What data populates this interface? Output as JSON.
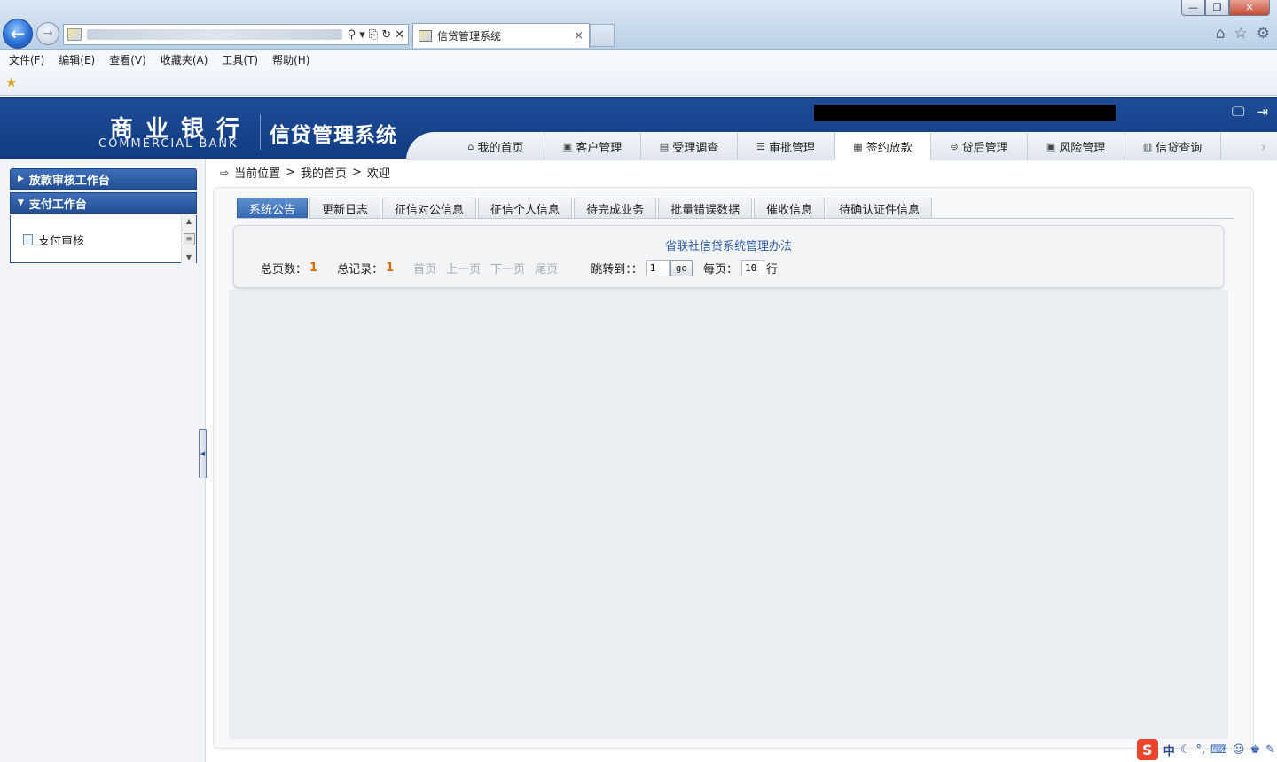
{
  "browser": {
    "tab_title": "信贷管理系统",
    "tab_close": "×",
    "window_min": "—",
    "window_max": "❐",
    "window_close": "✕",
    "back_glyph": "←",
    "fwd_glyph": "→",
    "addr_search": "⚲ ▾",
    "addr_compat": "⎘",
    "addr_refresh": "↻",
    "addr_stop": "✕",
    "home_glyph": "⌂",
    "fav_glyph": "☆",
    "tools_glyph": "⚙",
    "menu": [
      "文件(F)",
      "编辑(E)",
      "查看(V)",
      "收藏夹(A)",
      "工具(T)",
      "帮助(H)"
    ]
  },
  "header": {
    "logo_cn": "商业银行",
    "logo_en": "COMMERCIAL BANK",
    "system_title": "信贷管理系统",
    "nav_tabs": [
      {
        "label": "我的首页",
        "icon": "home-icon"
      },
      {
        "label": "客户管理",
        "icon": "customer-icon"
      },
      {
        "label": "受理调查",
        "icon": "survey-icon"
      },
      {
        "label": "审批管理",
        "icon": "approval-icon"
      },
      {
        "label": "签约放款",
        "icon": "contract-icon",
        "active": true
      },
      {
        "label": "贷后管理",
        "icon": "postloan-icon"
      },
      {
        "label": "风险管理",
        "icon": "risk-icon"
      },
      {
        "label": "信贷查询",
        "icon": "query-icon"
      }
    ]
  },
  "sidebar": {
    "groups": [
      {
        "label": "放款审核工作台",
        "expanded": false
      },
      {
        "label": "支付工作台",
        "expanded": true
      }
    ],
    "items": [
      {
        "label": "支付审核"
      }
    ]
  },
  "breadcrumb": {
    "label": "当前位置",
    "items": [
      "我的首页",
      "欢迎"
    ],
    "separator": ">"
  },
  "sub_tabs": [
    {
      "label": "系统公告",
      "active": true
    },
    {
      "label": "更新日志"
    },
    {
      "label": "征信对公信息"
    },
    {
      "label": "征信个人信息"
    },
    {
      "label": "待完成业务"
    },
    {
      "label": "批量错误数据"
    },
    {
      "label": "催收信息"
    },
    {
      "label": "待确认证件信息"
    }
  ],
  "notice": {
    "link_text": "省联社信贷系统管理办法"
  },
  "pager": {
    "total_pages_label": "总页数：",
    "total_pages": "1",
    "total_records_label": "总记录：",
    "total_records": "1",
    "first": "首页",
    "prev": "上一页",
    "next": "下一页",
    "last": "尾页",
    "jump_label": "跳转到：：",
    "jump_value": "1",
    "go_label": "go",
    "per_page_label": "每页：",
    "per_page_value": "10",
    "per_page_unit": "行"
  },
  "ime": {
    "logo": "S",
    "lang": "中"
  },
  "colors": {
    "header_blue": "#1d4c96",
    "accent_orange": "#d46b00",
    "link_blue": "#2f5da5"
  }
}
